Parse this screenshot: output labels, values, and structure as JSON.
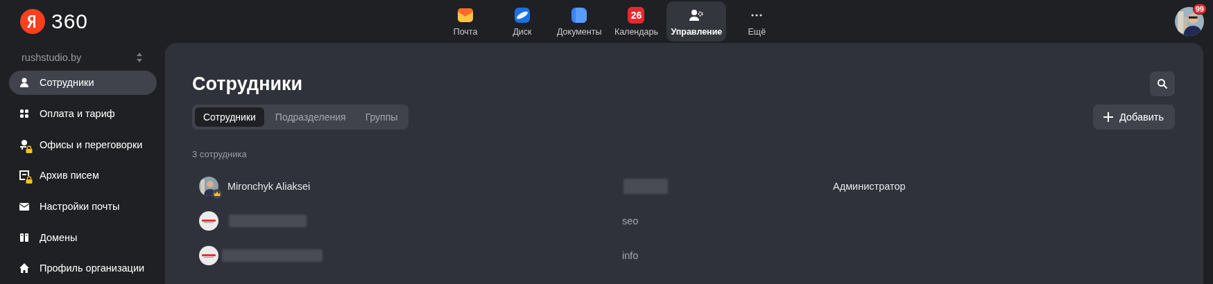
{
  "logo": {
    "text": "360"
  },
  "apps": [
    {
      "label": "Почта",
      "selected": false
    },
    {
      "label": "Диск",
      "selected": false
    },
    {
      "label": "Документы",
      "selected": false
    },
    {
      "label": "Календарь",
      "selected": false,
      "badge": "26"
    },
    {
      "label": "Управление",
      "selected": true
    },
    {
      "label": "Ещё",
      "selected": false
    }
  ],
  "user": {
    "badge": "99"
  },
  "sidebar": {
    "organization": "rushstudio.by",
    "items": [
      {
        "label": "Сотрудники",
        "selected": true,
        "locked": false
      },
      {
        "label": "Оплата и тариф",
        "selected": false,
        "locked": false
      },
      {
        "label": "Офисы и переговорки",
        "selected": false,
        "locked": true
      },
      {
        "label": "Архив писем",
        "selected": false,
        "locked": true
      },
      {
        "label": "Настройки почты",
        "selected": false,
        "locked": false
      },
      {
        "label": "Домены",
        "selected": false,
        "locked": false
      },
      {
        "label": "Профиль организации",
        "selected": false,
        "locked": false
      }
    ]
  },
  "page": {
    "title": "Сотрудники",
    "add_button": "Добавить",
    "tabs": [
      {
        "label": "Сотрудники",
        "selected": true
      },
      {
        "label": "Подразделения",
        "selected": false
      },
      {
        "label": "Группы",
        "selected": false
      }
    ],
    "count": "3 сотрудника",
    "rows": [
      {
        "admin": true,
        "name": "Mironchyk Aliaksei",
        "role": "Администратор"
      },
      {
        "admin": false,
        "department": "seo"
      },
      {
        "admin": false,
        "department": "info"
      }
    ]
  }
}
